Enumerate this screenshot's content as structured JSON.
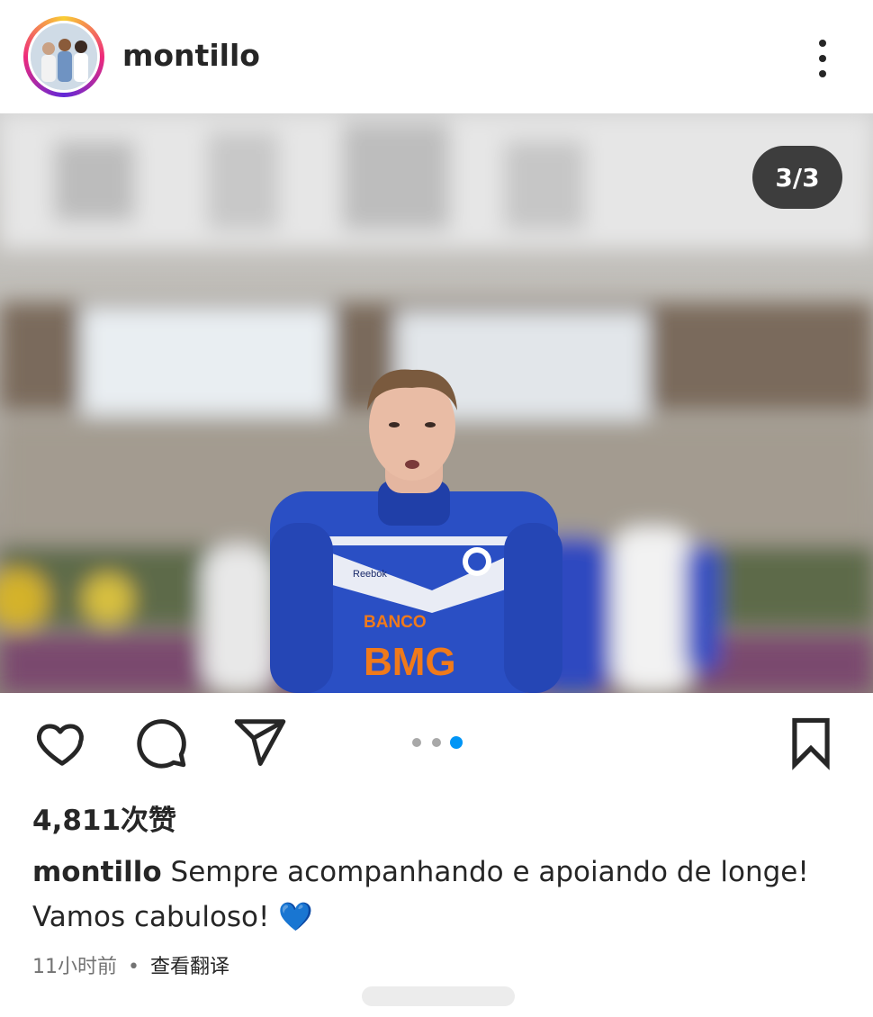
{
  "post": {
    "username": "montillo",
    "more_icon": "more-vertical-icon",
    "photo_counter": "3/3",
    "photo_subject": "player-in-blue-jersey",
    "jersey": {
      "sponsor_top": "BANCO",
      "sponsor_main": "BMG",
      "brand": "Reebok"
    },
    "likes": "4,811次赞",
    "caption_user": "montillo",
    "caption_text": " Sempre acompanhando e apoiando de longe! Vamos cabuloso! 💙",
    "time_ago": "11小时前",
    "separator": "•",
    "translate_label": "查看翻译",
    "carousel": {
      "total": 3,
      "active_index": 2
    }
  },
  "icons": {
    "like": "heart-icon",
    "comment": "comment-icon",
    "share": "send-icon",
    "save": "bookmark-icon"
  },
  "colors": {
    "text": "#262626",
    "muted": "#737373",
    "accent_blue": "#0095f6",
    "jersey_blue": "#2a4fc4"
  }
}
